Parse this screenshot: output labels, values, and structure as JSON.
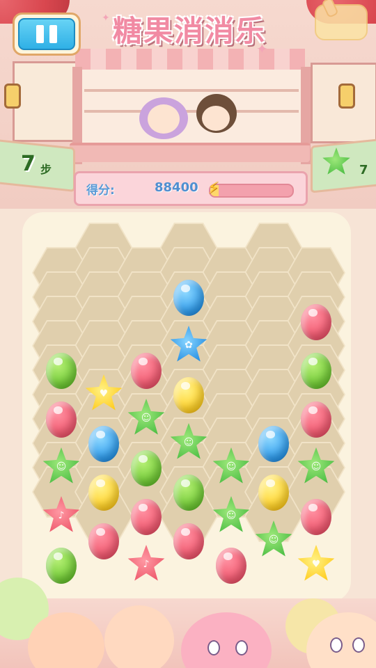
{
  "title": "糖果消消乐",
  "moves": {
    "value": "7",
    "unit": "步"
  },
  "goal": {
    "icon": "green-star-candy",
    "count": "7"
  },
  "score": {
    "label": "得分:",
    "value": "88400",
    "progress": 0.1
  },
  "board": {
    "hex_cells": [
      [
        1,
        0
      ],
      [
        3,
        0
      ],
      [
        5,
        0
      ],
      [
        0,
        1
      ],
      [
        1,
        1
      ],
      [
        2,
        1
      ],
      [
        3,
        1
      ],
      [
        4,
        1
      ],
      [
        5,
        1
      ],
      [
        6,
        1
      ],
      [
        0,
        2
      ],
      [
        1,
        2
      ],
      [
        2,
        2
      ],
      [
        3,
        2
      ],
      [
        4,
        2
      ],
      [
        5,
        2
      ],
      [
        6,
        2
      ],
      [
        0,
        3
      ],
      [
        1,
        3
      ],
      [
        2,
        3
      ],
      [
        3,
        3
      ],
      [
        4,
        3
      ],
      [
        5,
        3
      ],
      [
        6,
        3
      ],
      [
        0,
        4
      ],
      [
        1,
        4
      ],
      [
        2,
        4
      ],
      [
        3,
        4
      ],
      [
        4,
        4
      ],
      [
        5,
        4
      ],
      [
        6,
        4
      ],
      [
        0,
        5
      ],
      [
        1,
        5
      ],
      [
        2,
        5
      ],
      [
        3,
        5
      ],
      [
        4,
        5
      ],
      [
        5,
        5
      ],
      [
        6,
        5
      ],
      [
        0,
        6
      ],
      [
        1,
        6
      ],
      [
        2,
        6
      ],
      [
        3,
        6
      ],
      [
        4,
        6
      ],
      [
        5,
        6
      ],
      [
        6,
        6
      ],
      [
        0,
        7
      ],
      [
        1,
        7
      ],
      [
        2,
        7
      ],
      [
        3,
        7
      ],
      [
        4,
        7
      ],
      [
        5,
        7
      ],
      [
        6,
        7
      ],
      [
        0,
        8
      ],
      [
        1,
        8
      ],
      [
        2,
        8
      ],
      [
        3,
        8
      ],
      [
        4,
        8
      ],
      [
        5,
        8
      ],
      [
        6,
        8
      ],
      [
        0,
        9
      ],
      [
        1,
        9
      ],
      [
        2,
        9
      ],
      [
        3,
        9
      ],
      [
        4,
        9
      ],
      [
        5,
        9
      ],
      [
        6,
        9
      ],
      [
        0,
        10
      ],
      [
        1,
        10
      ],
      [
        2,
        10
      ],
      [
        3,
        10
      ],
      [
        4,
        10
      ],
      [
        5,
        10
      ],
      [
        6,
        10
      ],
      [
        1,
        11
      ],
      [
        3,
        11
      ],
      [
        5,
        11
      ]
    ],
    "candies": [
      {
        "col": 3,
        "row": 2,
        "shape": "oval",
        "color": "blue"
      },
      {
        "col": 6,
        "row": 3,
        "shape": "oval",
        "color": "red"
      },
      {
        "col": 3,
        "row": 4,
        "shape": "star",
        "color": "blue"
      },
      {
        "col": 0,
        "row": 5,
        "shape": "oval",
        "color": "green"
      },
      {
        "col": 2,
        "row": 5,
        "shape": "oval",
        "color": "red"
      },
      {
        "col": 6,
        "row": 5,
        "shape": "oval",
        "color": "green"
      },
      {
        "col": 1,
        "row": 6,
        "shape": "star",
        "color": "yellow"
      },
      {
        "col": 3,
        "row": 6,
        "shape": "oval",
        "color": "yellow"
      },
      {
        "col": 0,
        "row": 7,
        "shape": "oval",
        "color": "red"
      },
      {
        "col": 2,
        "row": 7,
        "shape": "star",
        "color": "green"
      },
      {
        "col": 6,
        "row": 7,
        "shape": "oval",
        "color": "red"
      },
      {
        "col": 1,
        "row": 8,
        "shape": "oval",
        "color": "blue"
      },
      {
        "col": 3,
        "row": 8,
        "shape": "star",
        "color": "green"
      },
      {
        "col": 5,
        "row": 8,
        "shape": "oval",
        "color": "blue"
      },
      {
        "col": 0,
        "row": 9,
        "shape": "star",
        "color": "green"
      },
      {
        "col": 2,
        "row": 9,
        "shape": "oval",
        "color": "green"
      },
      {
        "col": 4,
        "row": 9,
        "shape": "star",
        "color": "green"
      },
      {
        "col": 6,
        "row": 9,
        "shape": "star",
        "color": "green"
      },
      {
        "col": 1,
        "row": 10,
        "shape": "oval",
        "color": "yellow"
      },
      {
        "col": 3,
        "row": 10,
        "shape": "oval",
        "color": "green"
      },
      {
        "col": 5,
        "row": 10,
        "shape": "oval",
        "color": "yellow"
      },
      {
        "col": 0,
        "row": 11,
        "shape": "star",
        "color": "red"
      },
      {
        "col": 2,
        "row": 11,
        "shape": "oval",
        "color": "red"
      },
      {
        "col": 4,
        "row": 11,
        "shape": "star",
        "color": "green"
      },
      {
        "col": 6,
        "row": 11,
        "shape": "oval",
        "color": "red"
      },
      {
        "col": 1,
        "row": 12,
        "shape": "oval",
        "color": "red"
      },
      {
        "col": 3,
        "row": 12,
        "shape": "oval",
        "color": "red"
      },
      {
        "col": 5,
        "row": 12,
        "shape": "star",
        "color": "green"
      },
      {
        "col": 0,
        "row": 13,
        "shape": "oval",
        "color": "green"
      },
      {
        "col": 2,
        "row": 13,
        "shape": "star",
        "color": "red"
      },
      {
        "col": 4,
        "row": 13,
        "shape": "oval",
        "color": "red"
      },
      {
        "col": 6,
        "row": 13,
        "shape": "star",
        "color": "yellow"
      }
    ]
  },
  "icons": {
    "pause": "pause-icon",
    "bonus": "bolt-icon",
    "shop": "bunny-icon"
  },
  "colors": {
    "accent": "#f18aa3",
    "candy_red": "#f0566d",
    "candy_green": "#6cc632",
    "candy_blue": "#2b98ea",
    "candy_yellow": "#ffcf23"
  }
}
